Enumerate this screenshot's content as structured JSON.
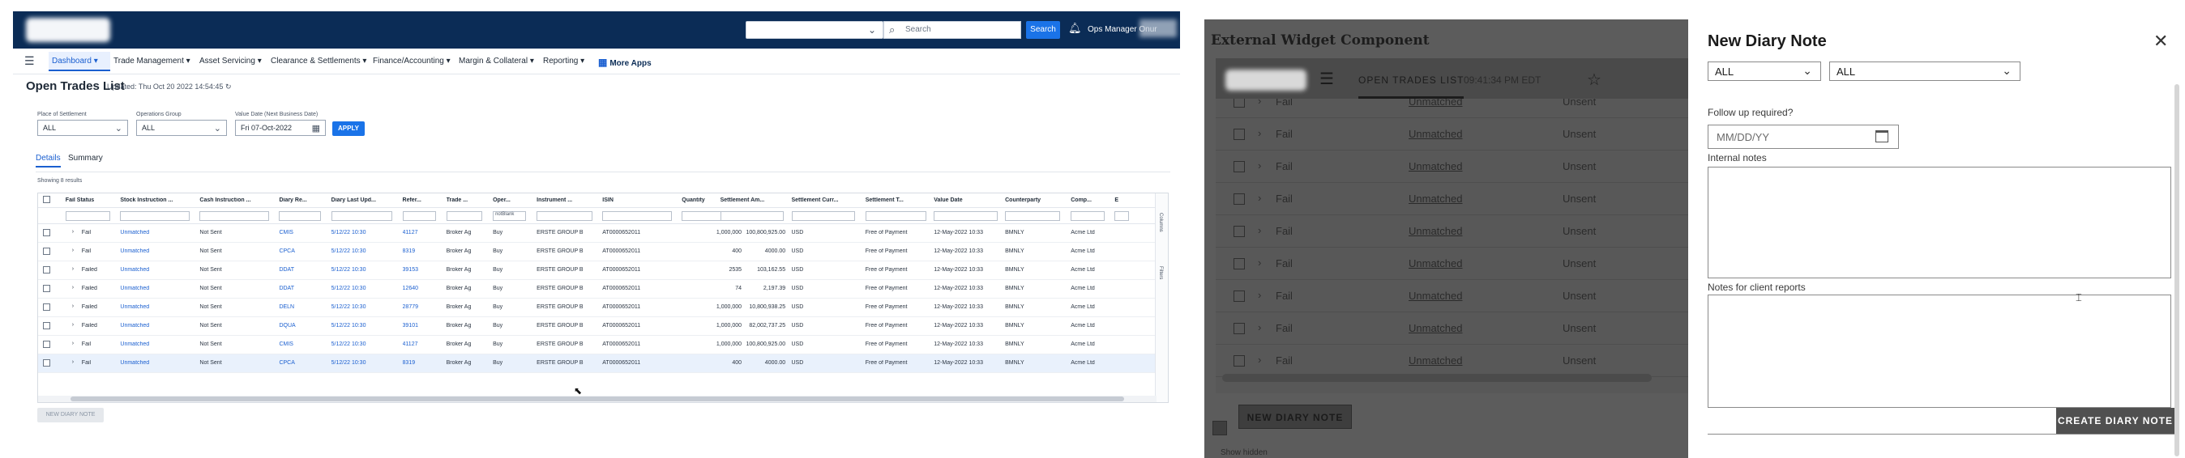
{
  "app": {
    "topbar": {
      "search_placeholder": "Search",
      "search_button": "Search",
      "user_label": "Ops Manager Onur"
    },
    "nav": [
      "Dashboard",
      "Trade Management",
      "Asset Servicing",
      "Clearance & Settlements",
      "Finance/Accounting",
      "Margin & Collateral",
      "Reporting",
      "More Apps"
    ],
    "page": {
      "title": "Open Trades List",
      "updated": "Updated: Thu Oct 20 2022 14:54:45"
    },
    "filters": [
      {
        "label": "Place of Settlement",
        "value": "ALL"
      },
      {
        "label": "Operations Group",
        "value": "ALL"
      },
      {
        "label": "Value Date (Next Business Date)",
        "value": "Fri 07-Oct-2022"
      }
    ],
    "apply_label": "APPLY",
    "tabs": [
      "Details",
      "Summary"
    ],
    "showing": "Showing 8 results",
    "grid": {
      "columns": [
        "Fail Status",
        "Stock Instruction ...",
        "Cash Instruction ...",
        "Diary Re...",
        "Diary Last Upd...",
        "Refer...",
        "Trade ...",
        "Oper...",
        "Instrument ...",
        "ISIN",
        "Quantity",
        "Settlement Am...",
        "Settlement Curr...",
        "Settlement T...",
        "Value Date",
        "Counterparty",
        "Comp...",
        "E"
      ],
      "filter_placeholder": "notBlank",
      "rail": [
        "Columns",
        "Filters"
      ],
      "rows": [
        [
          "Fail",
          "Unmatched",
          "Not Sent",
          "CMIS",
          "5/12/22 10:30",
          "41127",
          "Broker Ag",
          "Buy",
          "ERSTE GROUP B",
          "AT0000652011",
          "1,000,000",
          "100,800,925.00",
          "USD",
          "Free of Payment",
          "12-May-2022 10:33",
          "BMNLY",
          "Acme Ltd"
        ],
        [
          "Fail",
          "Unmatched",
          "Not Sent",
          "CPCA",
          "5/12/22 10:30",
          "8319",
          "Broker Ag",
          "Buy",
          "ERSTE GROUP B",
          "AT0000652011",
          "400",
          "4000.00",
          "USD",
          "Free of Payment",
          "12-May-2022 10:33",
          "BMNLY",
          "Acme Ltd"
        ],
        [
          "Failed",
          "Unmatched",
          "Not Sent",
          "DDAT",
          "5/12/22 10:30",
          "39153",
          "Broker Ag",
          "Buy",
          "ERSTE GROUP B",
          "AT0000652011",
          "2535",
          "103,162.55",
          "USD",
          "Free of Payment",
          "12-May-2022 10:33",
          "BMNLY",
          "Acme Ltd"
        ],
        [
          "Failed",
          "Unmatched",
          "Not Sent",
          "DDAT",
          "5/12/22 10:30",
          "12640",
          "Broker Ag",
          "Buy",
          "ERSTE GROUP B",
          "AT0000652011",
          "74",
          "2,197.39",
          "USD",
          "Free of Payment",
          "12-May-2022 10:33",
          "BMNLY",
          "Acme Ltd"
        ],
        [
          "Failed",
          "Unmatched",
          "Not Sent",
          "DELN",
          "5/12/22 10:30",
          "28779",
          "Broker Ag",
          "Buy",
          "ERSTE GROUP B",
          "AT0000652011",
          "1,000,000",
          "10,800,938.25",
          "USD",
          "Free of Payment",
          "12-May-2022 10:33",
          "BMNLY",
          "Acme Ltd"
        ],
        [
          "Failed",
          "Unmatched",
          "Not Sent",
          "DQUA",
          "5/12/22 10:30",
          "39101",
          "Broker Ag",
          "Buy",
          "ERSTE GROUP B",
          "AT0000652011",
          "1,000,000",
          "82,002,737.25",
          "USD",
          "Free of Payment",
          "12-May-2022 10:33",
          "BMNLY",
          "Acme Ltd"
        ],
        [
          "Fail",
          "Unmatched",
          "Not Sent",
          "CMIS",
          "5/12/22 10:30",
          "41127",
          "Broker Ag",
          "Buy",
          "ERSTE GROUP B",
          "AT0000652011",
          "1,000,000",
          "100,800,925.00",
          "USD",
          "Free of Payment",
          "12-May-2022 10:33",
          "BMNLY",
          "Acme Ltd"
        ],
        [
          "Fail",
          "Unmatched",
          "Not Sent",
          "CPCA",
          "5/12/22 10:30",
          "8319",
          "Broker Ag",
          "Buy",
          "ERSTE GROUP B",
          "AT0000652011",
          "400",
          "4000.00",
          "USD",
          "Free of Payment",
          "12-May-2022 10:33",
          "BMNLY",
          "Acme Ltd"
        ]
      ]
    },
    "new_diary_button": "NEW DIARY NOTE"
  },
  "panel": {
    "title": "External Widget Component",
    "tab": "OPEN TRADES LIST",
    "time": "09:41:34 PM EDT",
    "rows": [
      {
        "status": "Fail",
        "match": "Unmatched",
        "sent": "Unsent"
      },
      {
        "status": "Fail",
        "match": "Unmatched",
        "sent": "Unsent"
      },
      {
        "status": "Fail",
        "match": "Unmatched",
        "sent": "Unsent"
      },
      {
        "status": "Fail",
        "match": "Unmatched",
        "sent": "Unsent"
      },
      {
        "status": "Fail",
        "match": "Unmatched",
        "sent": "Unsent"
      },
      {
        "status": "Fail",
        "match": "Unmatched",
        "sent": "Unsent"
      },
      {
        "status": "Fail",
        "match": "Unmatched",
        "sent": "Unsent"
      },
      {
        "status": "Fail",
        "match": "Unmatched",
        "sent": "Unsent"
      },
      {
        "status": "Fail",
        "match": "Unmatched",
        "sent": "Unsent"
      }
    ],
    "new_diary_button": "NEW DIARY NOTE",
    "footer": "Show hidden"
  },
  "drawer": {
    "title": "New Diary Note",
    "select_a": "ALL",
    "select_b": "ALL",
    "follow_up_label": "Follow up required?",
    "date_placeholder": "MM/DD/YY",
    "internal_label": "Internal notes",
    "client_label": "Notes for client reports",
    "create_button": "CREATE DIARY NOTE"
  }
}
